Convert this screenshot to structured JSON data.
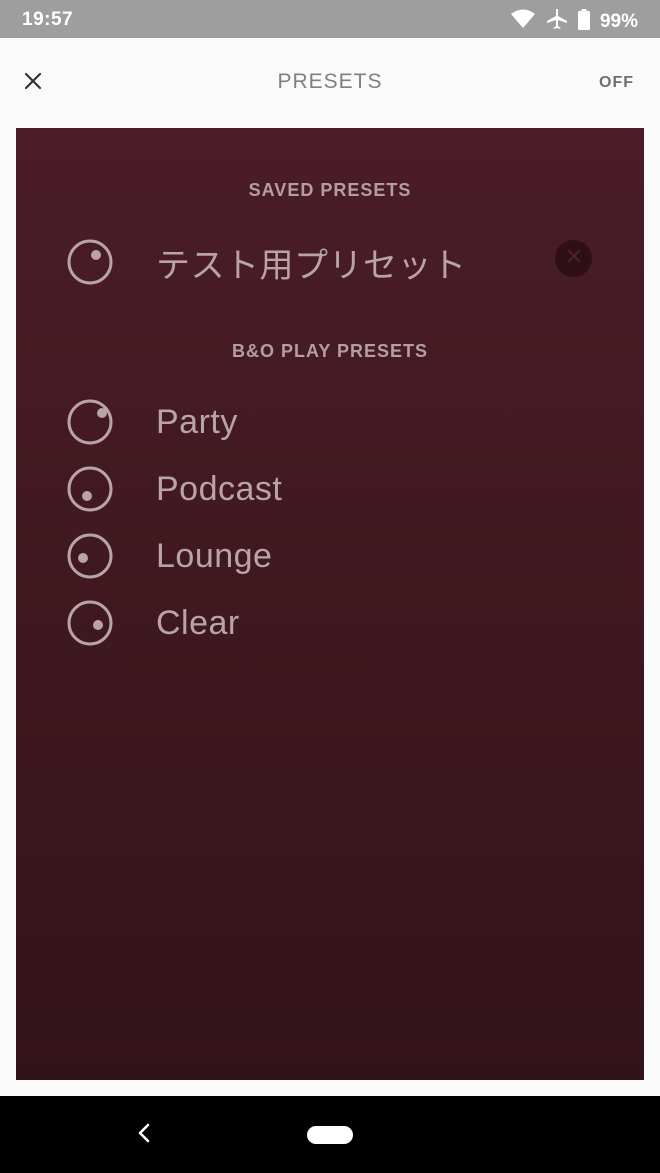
{
  "status_bar": {
    "time": "19:57",
    "battery_percent": "99%",
    "icons": [
      "wifi-icon",
      "airplane-icon",
      "battery-icon"
    ]
  },
  "header": {
    "title": "PRESETS",
    "off_label": "OFF",
    "close_icon": "close-icon"
  },
  "colors": {
    "panel_top": "#4a1d28",
    "panel_bottom": "#33131a",
    "text_muted": "#b59ea3"
  },
  "saved_presets": {
    "heading": "SAVED PRESETS",
    "items": [
      {
        "label": "テスト用プリセット",
        "icon": "preset-dial-icon"
      }
    ],
    "delete_icon": "delete-circle-icon"
  },
  "play_presets": {
    "heading": "B&O PLAY PRESETS",
    "items": [
      {
        "label": "Party",
        "icon": "preset-dial-icon"
      },
      {
        "label": "Podcast",
        "icon": "preset-dial-icon"
      },
      {
        "label": "Lounge",
        "icon": "preset-dial-icon"
      },
      {
        "label": "Clear",
        "icon": "preset-dial-icon"
      }
    ]
  },
  "nav_bar": {
    "icons": [
      "back-icon",
      "home-pill-icon"
    ]
  }
}
